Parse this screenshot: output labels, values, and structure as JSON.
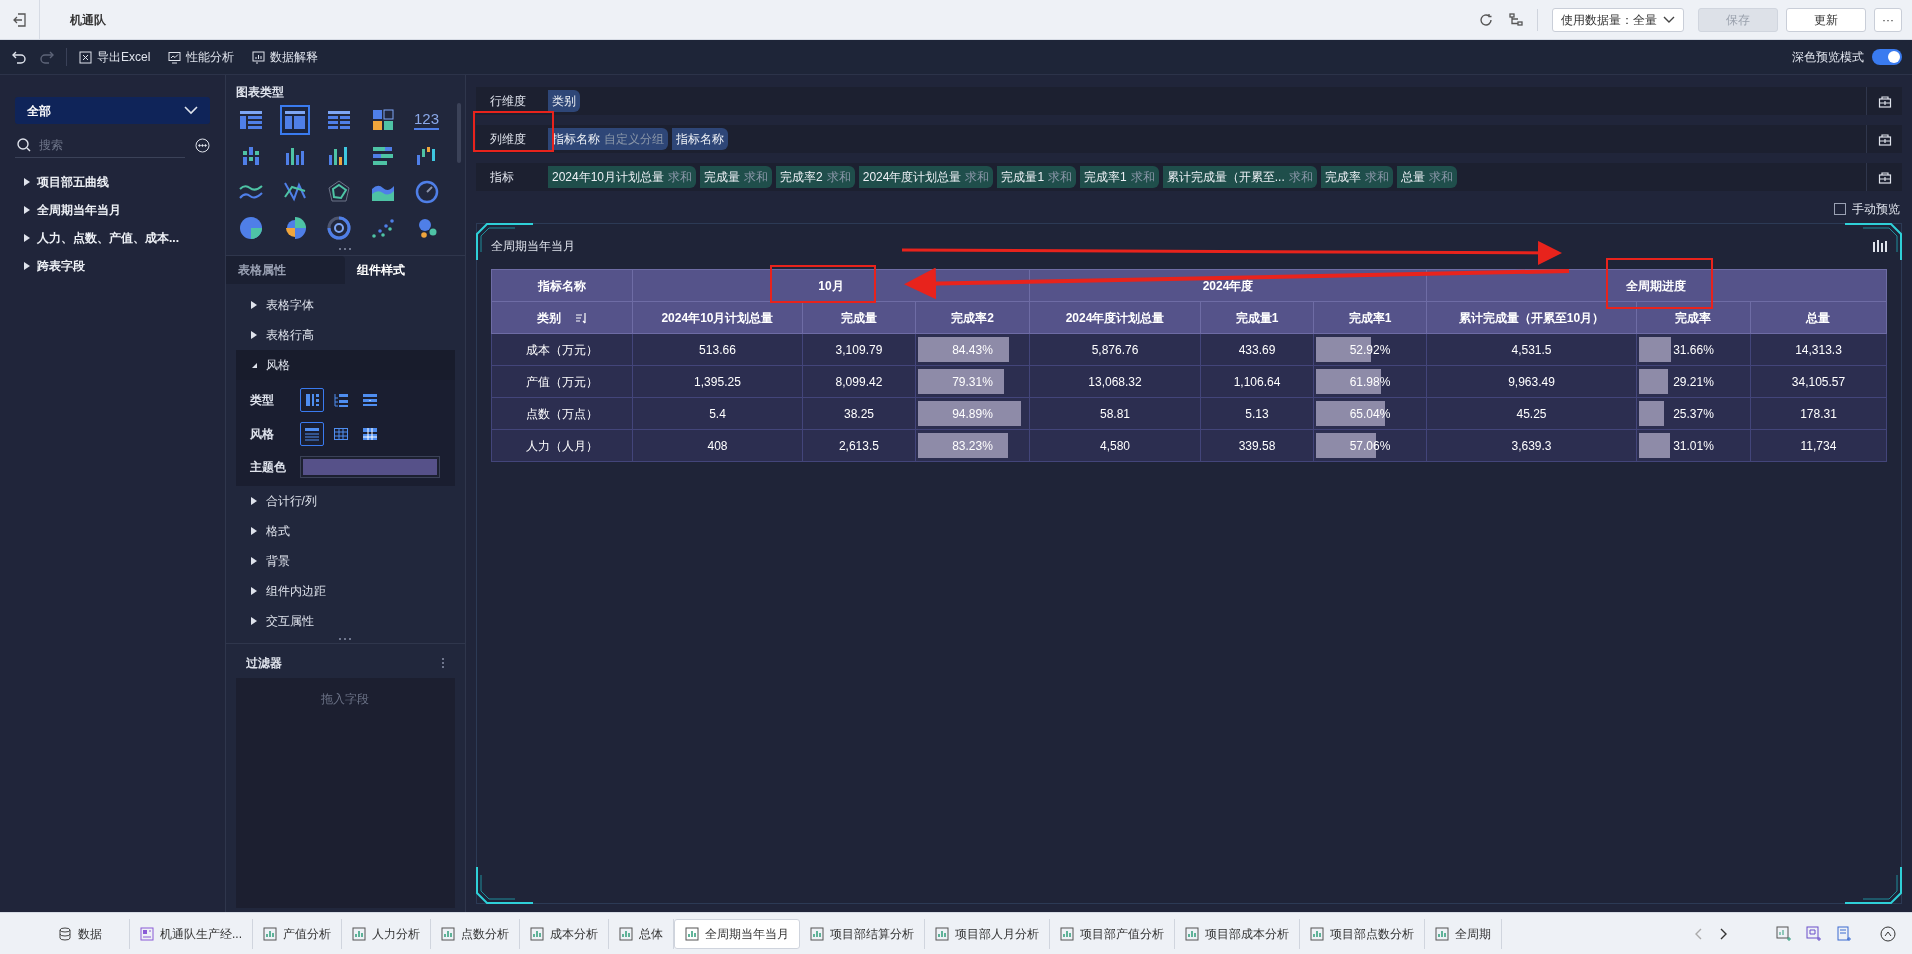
{
  "app_bar": {
    "title": "机通队",
    "data_volume": "使用数据量：全量",
    "buttons": [
      {
        "label": "保存",
        "disabled": true
      },
      {
        "label": "更新",
        "disabled": false
      }
    ],
    "more": "···"
  },
  "toolbar": {
    "actions": [
      {
        "label": "导出Excel",
        "kind": "excel"
      },
      {
        "label": "性能分析",
        "kind": "performance"
      },
      {
        "label": "数据解释",
        "kind": "explain"
      }
    ],
    "dark_preview": {
      "label": "深色预览模式",
      "on": true
    }
  },
  "data_panel": {
    "scope": "全部",
    "search_placeholder": "搜索",
    "folders": [
      {
        "label": "项目部五曲线",
        "expanded": false
      },
      {
        "label": "全周期当年当月",
        "expanded": false
      },
      {
        "label": "人力、点数、产值、成本...",
        "expanded": false
      },
      {
        "label": "跨表字段",
        "expanded": false
      }
    ]
  },
  "chart_types": {
    "title": "图表类型",
    "items": [
      {
        "kind": "table",
        "selected": false
      },
      {
        "kind": "cross_table",
        "selected": true
      },
      {
        "kind": "list_table",
        "selected": false
      },
      {
        "kind": "kpi",
        "selected": false
      },
      {
        "kind": "number",
        "label": "123",
        "selected": false
      },
      {
        "kind": "grid_bar",
        "selected": false
      },
      {
        "kind": "column",
        "selected": false
      },
      {
        "kind": "multi_column",
        "selected": false
      },
      {
        "kind": "bar_stack",
        "selected": false
      },
      {
        "kind": "waterfall",
        "selected": false
      },
      {
        "kind": "line",
        "selected": false
      },
      {
        "kind": "cross_line",
        "selected": false
      },
      {
        "kind": "radar",
        "selected": false
      },
      {
        "kind": "area",
        "selected": false
      },
      {
        "kind": "gauge",
        "selected": false
      },
      {
        "kind": "pie",
        "selected": false
      },
      {
        "kind": "rose",
        "selected": false
      },
      {
        "kind": "donut",
        "selected": false
      },
      {
        "kind": "scatter",
        "selected": false
      },
      {
        "kind": "bubble",
        "selected": false
      }
    ]
  },
  "property_tabs": [
    {
      "label": "表格属性",
      "selected": false
    },
    {
      "label": "组件样式",
      "selected": true
    }
  ],
  "style_sections": [
    {
      "label": "表格字体",
      "expanded": false
    },
    {
      "label": "表格行高",
      "expanded": false
    },
    {
      "label": "风格",
      "expanded": true,
      "settings": {
        "type_label": "类型",
        "type_options": [
          {
            "kind": "cross",
            "selected": true
          },
          {
            "kind": "tree",
            "selected": false
          },
          {
            "kind": "group",
            "selected": false
          }
        ],
        "style_label": "风格",
        "style_options": [
          {
            "kind": "rows",
            "selected": true
          },
          {
            "kind": "grid",
            "selected": false
          },
          {
            "kind": "header",
            "selected": false
          }
        ],
        "theme_label": "主题色"
      }
    },
    {
      "label": "合计行/列",
      "expanded": false
    },
    {
      "label": "格式",
      "expanded": false
    },
    {
      "label": "背景",
      "expanded": false
    },
    {
      "label": "组件内边距",
      "expanded": false
    },
    {
      "label": "交互属性",
      "expanded": false
    }
  ],
  "filter": {
    "title": "过滤器",
    "placeholder": "拖入字段"
  },
  "shelves": [
    {
      "label": "行维度",
      "kind": "dimension",
      "fields": [
        {
          "name": "类别"
        }
      ]
    },
    {
      "label": "列维度",
      "kind": "dimension",
      "fields": [
        {
          "name": "指标名称",
          "note": "自定义分组"
        },
        {
          "name": "指标名称"
        }
      ]
    },
    {
      "label": "指标",
      "kind": "measure",
      "fields": [
        {
          "name": "2024年10月计划总量",
          "note": "求和"
        },
        {
          "name": "完成量",
          "note": "求和"
        },
        {
          "name": "完成率2",
          "note": "求和"
        },
        {
          "name": "2024年度计划总量",
          "note": "求和"
        },
        {
          "name": "完成量1",
          "note": "求和"
        },
        {
          "name": "完成率1",
          "note": "求和"
        },
        {
          "name": "累计完成量（开累至...",
          "note": "求和"
        },
        {
          "name": "完成率",
          "note": "求和"
        },
        {
          "name": "总量",
          "note": "求和"
        }
      ]
    }
  ],
  "manual_preview": {
    "label": "手动预览",
    "checked": false
  },
  "widget": {
    "title": "全周期当年当月",
    "table": {
      "groups": [
        {
          "label": "指标名称",
          "columns": [
            {
              "label": "类别",
              "sortable": true
            }
          ]
        },
        {
          "label": "10月",
          "columns": [
            {
              "label": "2024年10月计划总量",
              "sortable": false
            },
            {
              "label": "完成量",
              "sortable": false
            },
            {
              "label": "完成率2",
              "sortable": false
            }
          ]
        },
        {
          "label": "2024年度",
          "columns": [
            {
              "label": "2024年度计划总量",
              "sortable": false
            },
            {
              "label": "完成量1",
              "sortable": false
            },
            {
              "label": "完成率1",
              "sortable": false
            }
          ]
        },
        {
          "label": "全周期进度",
          "columns": [
            {
              "label": "累计完成量（开累至10月）",
              "sortable": false
            },
            {
              "label": "完成率",
              "sortable": false
            },
            {
              "label": "总量",
              "sortable": false
            }
          ]
        }
      ],
      "rows": [
        [
          {
            "kind": "text",
            "text": "成本（万元）"
          },
          {
            "kind": "text",
            "text": "513.66"
          },
          {
            "kind": "text",
            "text": "3,109.79"
          },
          {
            "kind": "bar",
            "text": "84.43%",
            "level": 0.8443
          },
          {
            "kind": "text",
            "text": "5,876.76"
          },
          {
            "kind": "text",
            "text": "433.69"
          },
          {
            "kind": "bar",
            "text": "52.92%",
            "level": 0.5292
          },
          {
            "kind": "text",
            "text": "4,531.5"
          },
          {
            "kind": "bar",
            "text": "31.66%",
            "level": 0.3166
          },
          {
            "kind": "text",
            "text": "14,313.3"
          }
        ],
        [
          {
            "kind": "text",
            "text": "产值（万元）"
          },
          {
            "kind": "text",
            "text": "1,395.25"
          },
          {
            "kind": "text",
            "text": "8,099.42"
          },
          {
            "kind": "bar",
            "text": "79.31%",
            "level": 0.7931
          },
          {
            "kind": "text",
            "text": "13,068.32"
          },
          {
            "kind": "text",
            "text": "1,106.64"
          },
          {
            "kind": "bar",
            "text": "61.98%",
            "level": 0.6198
          },
          {
            "kind": "text",
            "text": "9,963.49"
          },
          {
            "kind": "bar",
            "text": "29.21%",
            "level": 0.2921
          },
          {
            "kind": "text",
            "text": "34,105.57"
          }
        ],
        [
          {
            "kind": "text",
            "text": "点数（万点）"
          },
          {
            "kind": "text",
            "text": "5.4"
          },
          {
            "kind": "text",
            "text": "38.25"
          },
          {
            "kind": "bar",
            "text": "94.89%",
            "level": 0.9489
          },
          {
            "kind": "text",
            "text": "58.81"
          },
          {
            "kind": "text",
            "text": "5.13"
          },
          {
            "kind": "bar",
            "text": "65.04%",
            "level": 0.6504
          },
          {
            "kind": "text",
            "text": "45.25"
          },
          {
            "kind": "bar",
            "text": "25.37%",
            "level": 0.2537
          },
          {
            "kind": "text",
            "text": "178.31"
          }
        ],
        [
          {
            "kind": "text",
            "text": "人力（人月）"
          },
          {
            "kind": "text",
            "text": "408"
          },
          {
            "kind": "text",
            "text": "2,613.5"
          },
          {
            "kind": "bar",
            "text": "83.23%",
            "level": 0.8323
          },
          {
            "kind": "text",
            "text": "4,580"
          },
          {
            "kind": "text",
            "text": "339.58"
          },
          {
            "kind": "bar",
            "text": "57.06%",
            "level": 0.5706
          },
          {
            "kind": "text",
            "text": "3,639.3"
          },
          {
            "kind": "bar",
            "text": "31.01%",
            "level": 0.3101
          },
          {
            "kind": "text",
            "text": "11,734"
          }
        ]
      ]
    }
  },
  "sheet_tabs": [
    {
      "label": "数据",
      "kind": "data",
      "selected": false
    },
    {
      "label": "机通队生产经...",
      "kind": "dashboard",
      "selected": false
    },
    {
      "label": "产值分析",
      "kind": "chart",
      "selected": false
    },
    {
      "label": "人力分析",
      "kind": "chart",
      "selected": false
    },
    {
      "label": "点数分析",
      "kind": "chart",
      "selected": false
    },
    {
      "label": "成本分析",
      "kind": "chart",
      "selected": false
    },
    {
      "label": "总体",
      "kind": "chart",
      "selected": false
    },
    {
      "label": "全周期当年当月",
      "kind": "chart",
      "selected": true
    },
    {
      "label": "项目部结算分析",
      "kind": "chart",
      "selected": false
    },
    {
      "label": "项目部人月分析",
      "kind": "chart",
      "selected": false
    },
    {
      "label": "项目部产值分析",
      "kind": "chart",
      "selected": false
    },
    {
      "label": "项目部成本分析",
      "kind": "chart",
      "selected": false
    },
    {
      "label": "项目部点数分析",
      "kind": "chart",
      "selected": false
    },
    {
      "label": "全周期",
      "kind": "chart",
      "selected": false
    }
  ]
}
